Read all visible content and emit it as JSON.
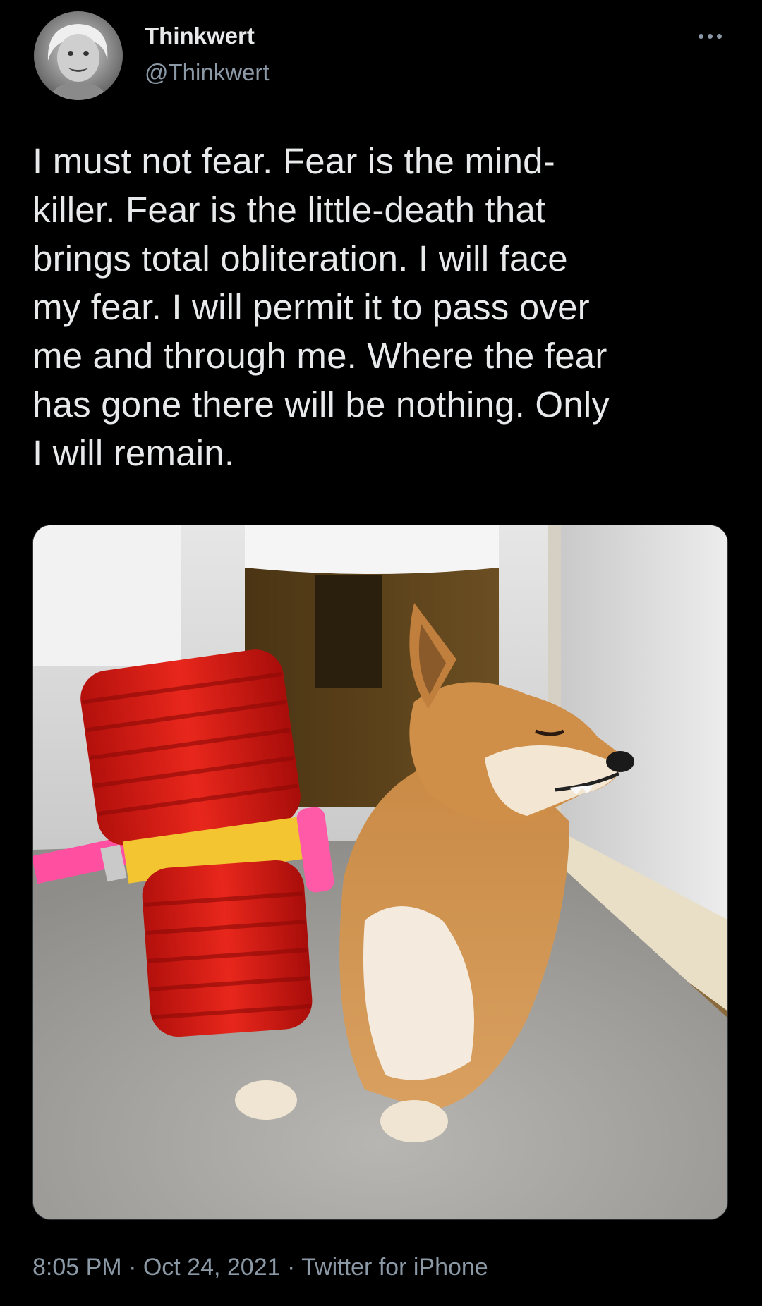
{
  "author": {
    "display_name": "Thinkwert",
    "handle": "@Thinkwert"
  },
  "menu_icon": "more-horizontal-icon",
  "tweet": {
    "text": "I must not fear. Fear is the mind-\nkiller. Fear is the little-death that\nbrings total obliteration. I will face\nmy fear. I will permit it to pass over\nme and through me. Where the fear\nhas gone there will be nothing. Only\nI will remain."
  },
  "meta": {
    "time": "8:05 PM",
    "separator": " · ",
    "date": "Oct 24, 2021",
    "source": "Twitter for iPhone"
  },
  "colors": {
    "background": "#000000",
    "text_primary": "#e7e9ea",
    "text_secondary": "#8b98a5"
  }
}
